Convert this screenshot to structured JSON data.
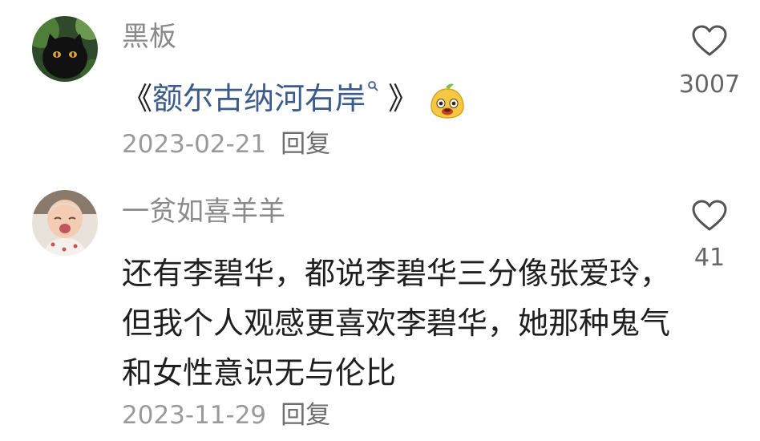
{
  "comments": [
    {
      "username": "黑板",
      "content_prefix": "《",
      "book_title": "额尔古纳河右岸",
      "content_suffix": " 》",
      "date": "2023-02-21",
      "reply_label": "回复",
      "like_count": "3007",
      "avatar_icon": "black-cat-avatar",
      "emoji_icon": "yellow-pear-face-emoji"
    },
    {
      "username": "一贫如喜羊羊",
      "content": "还有李碧华，都说李碧华三分像张爱玲，但我个人观感更喜欢李碧华，她那种鬼气和女性意识无与伦比",
      "date": "2023-11-29",
      "reply_label": "回复",
      "like_count": "41",
      "avatar_icon": "crying-baby-avatar"
    }
  ],
  "colors": {
    "username": "#8a8a8a",
    "link": "#3c5b8a",
    "meta": "#9a9a9a"
  }
}
